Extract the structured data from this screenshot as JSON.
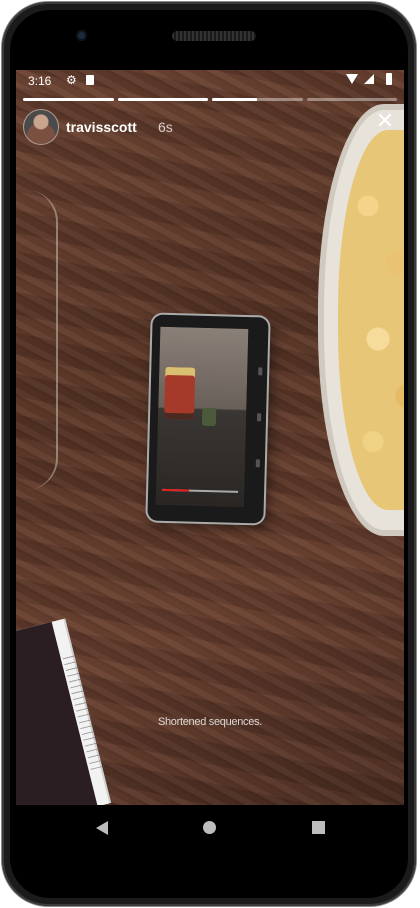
{
  "status_bar": {
    "time": "3:16",
    "gear_icon": "gear-icon",
    "sim_icon": "sim-card-icon",
    "wifi_icon": "wifi-icon",
    "signal_icon": "cell-signal-icon",
    "battery_icon": "battery-icon"
  },
  "story": {
    "segments_progress": [
      1,
      1,
      0.5,
      0
    ],
    "username": "travisscott",
    "time_ago": "6s",
    "close_glyph": "✕",
    "caption": "Shortened sequences."
  },
  "mini_player": {
    "progress": 0.35
  },
  "nav_bar": {
    "back_icon": "back-triangle-icon",
    "home_icon": "home-circle-icon",
    "recents_icon": "recents-square-icon"
  }
}
